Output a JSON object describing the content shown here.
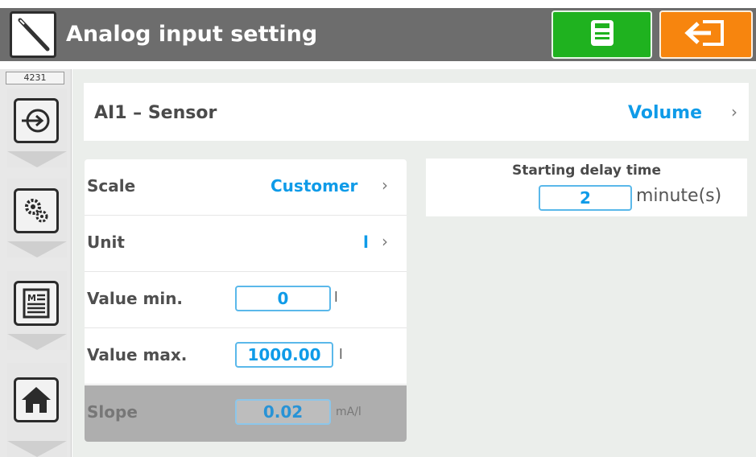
{
  "header": {
    "title": "Analog input setting",
    "save_icon": "save-icon",
    "exit_icon": "exit-icon",
    "colors": {
      "save": "#1fb21f",
      "exit": "#f7850e",
      "bar": "#6d6d6d"
    }
  },
  "sidebar": {
    "tag": "4231",
    "items": [
      {
        "icon": "input-icon"
      },
      {
        "icon": "settings-icon"
      },
      {
        "icon": "manual-icon"
      },
      {
        "icon": "home-icon"
      }
    ]
  },
  "ai": {
    "label": "AI1 – Sensor",
    "value": "Volume"
  },
  "scale": {
    "label": "Scale",
    "value": "Customer"
  },
  "unit": {
    "label": "Unit",
    "value": "l"
  },
  "value_min": {
    "label": "Value min.",
    "value": "0",
    "unit": "l"
  },
  "value_max": {
    "label": "Value max.",
    "value": "1000.00",
    "unit": "l"
  },
  "slope": {
    "label": "Slope",
    "value": "0.02",
    "unit": "mA/l"
  },
  "delay": {
    "title": "Starting delay time",
    "value": "2",
    "unit": "minute(s)"
  },
  "accent": "#0f9be8"
}
